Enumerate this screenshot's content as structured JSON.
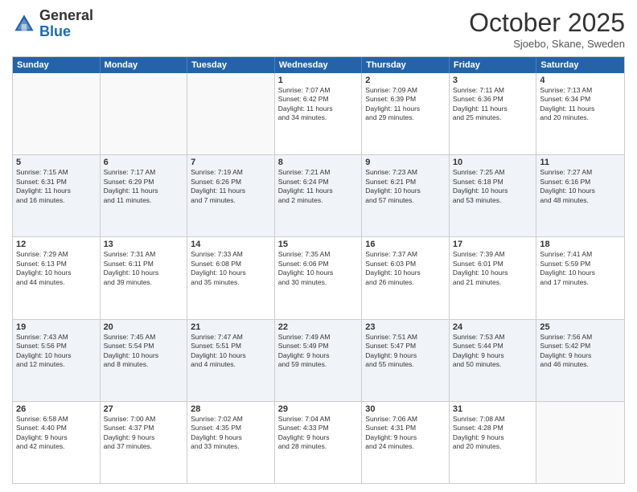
{
  "logo": {
    "general": "General",
    "blue": "Blue"
  },
  "title": "October 2025",
  "subtitle": "Sjoebo, Skane, Sweden",
  "dayHeaders": [
    "Sunday",
    "Monday",
    "Tuesday",
    "Wednesday",
    "Thursday",
    "Friday",
    "Saturday"
  ],
  "weeks": [
    [
      {
        "day": "",
        "info": ""
      },
      {
        "day": "",
        "info": ""
      },
      {
        "day": "",
        "info": ""
      },
      {
        "day": "1",
        "info": "Sunrise: 7:07 AM\nSunset: 6:42 PM\nDaylight: 11 hours\nand 34 minutes."
      },
      {
        "day": "2",
        "info": "Sunrise: 7:09 AM\nSunset: 6:39 PM\nDaylight: 11 hours\nand 29 minutes."
      },
      {
        "day": "3",
        "info": "Sunrise: 7:11 AM\nSunset: 6:36 PM\nDaylight: 11 hours\nand 25 minutes."
      },
      {
        "day": "4",
        "info": "Sunrise: 7:13 AM\nSunset: 6:34 PM\nDaylight: 11 hours\nand 20 minutes."
      }
    ],
    [
      {
        "day": "5",
        "info": "Sunrise: 7:15 AM\nSunset: 6:31 PM\nDaylight: 11 hours\nand 16 minutes."
      },
      {
        "day": "6",
        "info": "Sunrise: 7:17 AM\nSunset: 6:29 PM\nDaylight: 11 hours\nand 11 minutes."
      },
      {
        "day": "7",
        "info": "Sunrise: 7:19 AM\nSunset: 6:26 PM\nDaylight: 11 hours\nand 7 minutes."
      },
      {
        "day": "8",
        "info": "Sunrise: 7:21 AM\nSunset: 6:24 PM\nDaylight: 11 hours\nand 2 minutes."
      },
      {
        "day": "9",
        "info": "Sunrise: 7:23 AM\nSunset: 6:21 PM\nDaylight: 10 hours\nand 57 minutes."
      },
      {
        "day": "10",
        "info": "Sunrise: 7:25 AM\nSunset: 6:18 PM\nDaylight: 10 hours\nand 53 minutes."
      },
      {
        "day": "11",
        "info": "Sunrise: 7:27 AM\nSunset: 6:16 PM\nDaylight: 10 hours\nand 48 minutes."
      }
    ],
    [
      {
        "day": "12",
        "info": "Sunrise: 7:29 AM\nSunset: 6:13 PM\nDaylight: 10 hours\nand 44 minutes."
      },
      {
        "day": "13",
        "info": "Sunrise: 7:31 AM\nSunset: 6:11 PM\nDaylight: 10 hours\nand 39 minutes."
      },
      {
        "day": "14",
        "info": "Sunrise: 7:33 AM\nSunset: 6:08 PM\nDaylight: 10 hours\nand 35 minutes."
      },
      {
        "day": "15",
        "info": "Sunrise: 7:35 AM\nSunset: 6:06 PM\nDaylight: 10 hours\nand 30 minutes."
      },
      {
        "day": "16",
        "info": "Sunrise: 7:37 AM\nSunset: 6:03 PM\nDaylight: 10 hours\nand 26 minutes."
      },
      {
        "day": "17",
        "info": "Sunrise: 7:39 AM\nSunset: 6:01 PM\nDaylight: 10 hours\nand 21 minutes."
      },
      {
        "day": "18",
        "info": "Sunrise: 7:41 AM\nSunset: 5:59 PM\nDaylight: 10 hours\nand 17 minutes."
      }
    ],
    [
      {
        "day": "19",
        "info": "Sunrise: 7:43 AM\nSunset: 5:56 PM\nDaylight: 10 hours\nand 12 minutes."
      },
      {
        "day": "20",
        "info": "Sunrise: 7:45 AM\nSunset: 5:54 PM\nDaylight: 10 hours\nand 8 minutes."
      },
      {
        "day": "21",
        "info": "Sunrise: 7:47 AM\nSunset: 5:51 PM\nDaylight: 10 hours\nand 4 minutes."
      },
      {
        "day": "22",
        "info": "Sunrise: 7:49 AM\nSunset: 5:49 PM\nDaylight: 9 hours\nand 59 minutes."
      },
      {
        "day": "23",
        "info": "Sunrise: 7:51 AM\nSunset: 5:47 PM\nDaylight: 9 hours\nand 55 minutes."
      },
      {
        "day": "24",
        "info": "Sunrise: 7:53 AM\nSunset: 5:44 PM\nDaylight: 9 hours\nand 50 minutes."
      },
      {
        "day": "25",
        "info": "Sunrise: 7:56 AM\nSunset: 5:42 PM\nDaylight: 9 hours\nand 46 minutes."
      }
    ],
    [
      {
        "day": "26",
        "info": "Sunrise: 6:58 AM\nSunset: 4:40 PM\nDaylight: 9 hours\nand 42 minutes."
      },
      {
        "day": "27",
        "info": "Sunrise: 7:00 AM\nSunset: 4:37 PM\nDaylight: 9 hours\nand 37 minutes."
      },
      {
        "day": "28",
        "info": "Sunrise: 7:02 AM\nSunset: 4:35 PM\nDaylight: 9 hours\nand 33 minutes."
      },
      {
        "day": "29",
        "info": "Sunrise: 7:04 AM\nSunset: 4:33 PM\nDaylight: 9 hours\nand 28 minutes."
      },
      {
        "day": "30",
        "info": "Sunrise: 7:06 AM\nSunset: 4:31 PM\nDaylight: 9 hours\nand 24 minutes."
      },
      {
        "day": "31",
        "info": "Sunrise: 7:08 AM\nSunset: 4:28 PM\nDaylight: 9 hours\nand 20 minutes."
      },
      {
        "day": "",
        "info": ""
      }
    ]
  ]
}
